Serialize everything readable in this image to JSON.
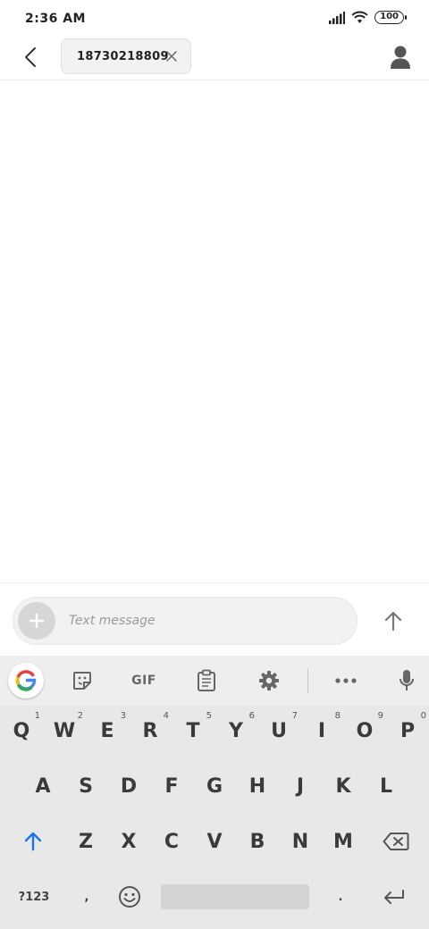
{
  "status_bar": {
    "time": "2:36 AM",
    "battery": "100"
  },
  "header": {
    "recipient": "18730218809"
  },
  "compose": {
    "placeholder": "Text message"
  },
  "keyboard": {
    "toolbar": {
      "gif_label": "GIF"
    },
    "row1": [
      {
        "label": "Q",
        "hint": "1"
      },
      {
        "label": "W",
        "hint": "2"
      },
      {
        "label": "E",
        "hint": "3"
      },
      {
        "label": "R",
        "hint": "4"
      },
      {
        "label": "T",
        "hint": "5"
      },
      {
        "label": "Y",
        "hint": "6"
      },
      {
        "label": "U",
        "hint": "7"
      },
      {
        "label": "I",
        "hint": "8"
      },
      {
        "label": "O",
        "hint": "9"
      },
      {
        "label": "P",
        "hint": "0"
      }
    ],
    "row2": [
      "A",
      "S",
      "D",
      "F",
      "G",
      "H",
      "J",
      "K",
      "L"
    ],
    "row3": [
      "Z",
      "X",
      "C",
      "V",
      "B",
      "N",
      "M"
    ],
    "symbols_label": "?123",
    "comma": ",",
    "period": "."
  },
  "colors": {
    "accent": "#1a73e8",
    "keyboard_bg": "#e8e8e8",
    "toolbar_bg": "#eeeeee"
  },
  "icons": {
    "back": "arrow-left-icon",
    "chip_close": "close-icon",
    "contact": "person-icon",
    "add": "plus-icon",
    "send": "arrow-up-icon",
    "google": "google-g-icon",
    "sticker": "sticker-icon",
    "clipboard": "clipboard-icon",
    "settings": "gear-icon",
    "more": "more-horizontal-icon",
    "mic": "microphone-icon",
    "shift": "shift-arrow-icon",
    "backspace": "backspace-icon",
    "emoji": "smiley-icon",
    "enter": "enter-return-icon"
  }
}
